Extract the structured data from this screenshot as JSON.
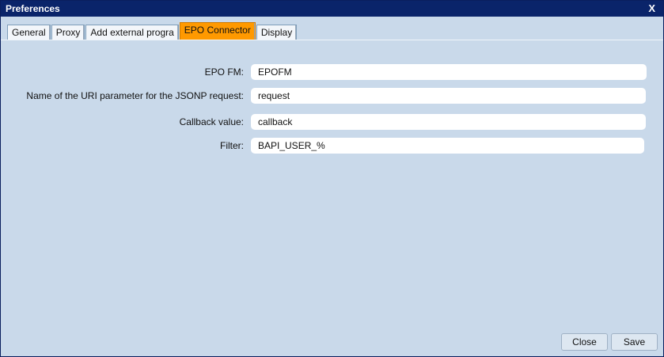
{
  "window": {
    "title": "Preferences",
    "close_glyph": "X"
  },
  "tabs": [
    {
      "label": "General"
    },
    {
      "label": "Proxy"
    },
    {
      "label": "Add external progra"
    },
    {
      "label": "EPO Connector",
      "active": true
    },
    {
      "label": "Display"
    }
  ],
  "form": {
    "epo_fm": {
      "label": "EPO FM:",
      "value": "EPOFM"
    },
    "uri_param": {
      "label": "Name of the URI parameter for the JSONP request:",
      "value": "request"
    },
    "callback": {
      "label": "Callback value:",
      "value": "callback"
    },
    "filter": {
      "label": "Filter:",
      "value": "BAPI_USER_%"
    }
  },
  "buttons": {
    "close": "Close",
    "save": "Save"
  },
  "colors": {
    "titlebar": "#0a246a",
    "active_tab": "#ff9900",
    "background": "#c9d9ea"
  }
}
